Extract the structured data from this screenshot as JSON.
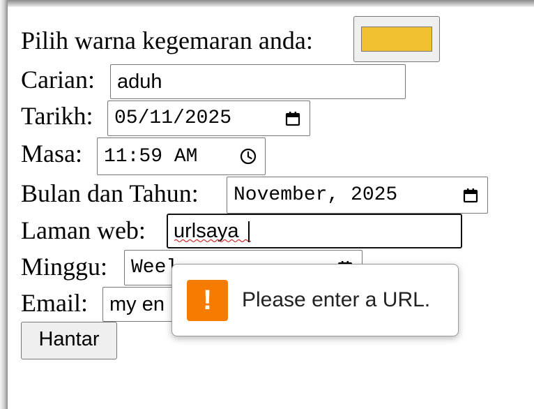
{
  "form": {
    "color_label": "Pilih warna kegemaran anda:",
    "color_value": "#f0c030",
    "search_label": "Carian:",
    "search_value": "aduh",
    "date_label": "Tarikh:",
    "date_value": "05/11/2025",
    "time_label": "Masa:",
    "time_value": "11:59 AM",
    "month_label": "Bulan dan Tahun:",
    "month_value": "November, 2025",
    "url_label": "Laman web:",
    "url_value": "urlsaya",
    "week_label": "Minggu:",
    "week_value_visible": "Weel",
    "email_label": "Email:",
    "email_value_visible": "my en",
    "submit_label": "Hantar"
  },
  "validation_tooltip": {
    "icon": "warning-icon",
    "icon_glyph": "!",
    "icon_color": "#f57c00",
    "message": "Please enter a URL."
  }
}
